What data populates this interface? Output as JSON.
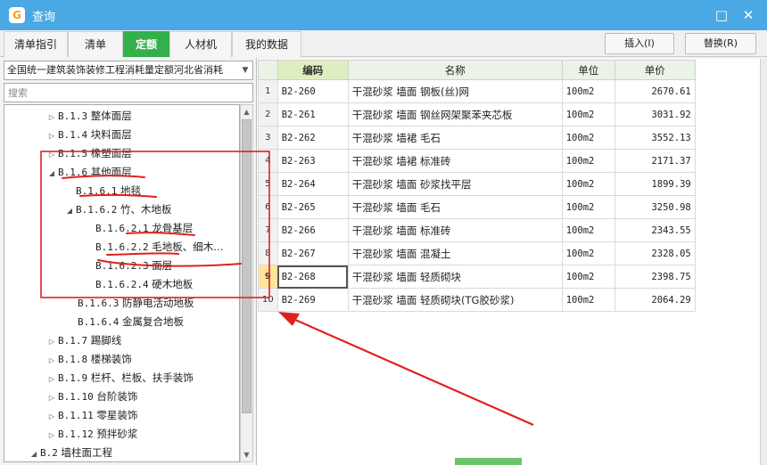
{
  "window": {
    "title": "查询",
    "app_icon": "G",
    "maximize_icon": "□",
    "close_icon": "✕"
  },
  "tabs": [
    "清单指引",
    "清单",
    "定额",
    "人材机",
    "我的数据"
  ],
  "active_tab": 2,
  "toolbar": {
    "insert_label": "插入(I)",
    "replace_label": "替换(R)"
  },
  "quota_library": {
    "selected": "全国统一建筑装饰装修工程消耗量定额河北省消耗"
  },
  "search": {
    "placeholder": "搜索"
  },
  "tree": [
    {
      "code": "B.1.3",
      "label": "整体面层"
    },
    {
      "code": "B.1.4",
      "label": "块料面层"
    },
    {
      "code": "B.1.5",
      "label": "橡塑面层"
    },
    {
      "code": "B.1.6",
      "label": "其他面层"
    },
    {
      "code": "B.1.6.1",
      "label": "地毯"
    },
    {
      "code": "B.1.6.2",
      "label": "竹、木地板"
    },
    {
      "code": "B.1.6.2.1",
      "label": "龙骨基层"
    },
    {
      "code": "B.1.6.2.2",
      "label": "毛地板、细木…"
    },
    {
      "code": "B.1.6.2.3",
      "label": "面层"
    },
    {
      "code": "B.1.6.2.4",
      "label": "硬木地板"
    },
    {
      "code": "B.1.6.3",
      "label": "防静电活动地板"
    },
    {
      "code": "B.1.6.4",
      "label": "金属复合地板"
    },
    {
      "code": "B.1.7",
      "label": "踢脚线"
    },
    {
      "code": "B.1.8",
      "label": "楼梯装饰"
    },
    {
      "code": "B.1.9",
      "label": "栏杆、栏板、扶手装饰"
    },
    {
      "code": "B.1.10",
      "label": "台阶装饰"
    },
    {
      "code": "B.1.11",
      "label": "零星装饰"
    },
    {
      "code": "B.1.12",
      "label": "预拌砂浆"
    },
    {
      "code": "B.2",
      "label": "墙柱面工程"
    }
  ],
  "table": {
    "columns": [
      "编码",
      "名称",
      "单位",
      "单价"
    ],
    "selected_row": 9,
    "rows": [
      {
        "num": "1",
        "code": "B2-260",
        "name": "干混砂浆 墙面 钢板(丝)网",
        "unit": "100m2",
        "price": "2670.61"
      },
      {
        "num": "2",
        "code": "B2-261",
        "name": "干混砂浆 墙面 钢丝网架聚苯夹芯板",
        "unit": "100m2",
        "price": "3031.92"
      },
      {
        "num": "3",
        "code": "B2-262",
        "name": "干混砂浆 墙裙 毛石",
        "unit": "100m2",
        "price": "3552.13"
      },
      {
        "num": "4",
        "code": "B2-263",
        "name": "干混砂浆 墙裙 标准砖",
        "unit": "100m2",
        "price": "2171.37"
      },
      {
        "num": "5",
        "code": "B2-264",
        "name": "干混砂浆 墙面 砂浆找平层",
        "unit": "100m2",
        "price": "1899.39"
      },
      {
        "num": "6",
        "code": "B2-265",
        "name": "干混砂浆 墙面 毛石",
        "unit": "100m2",
        "price": "3250.98"
      },
      {
        "num": "7",
        "code": "B2-266",
        "name": "干混砂浆 墙面 标准砖",
        "unit": "100m2",
        "price": "2343.55"
      },
      {
        "num": "8",
        "code": "B2-267",
        "name": "干混砂浆 墙面 混凝土",
        "unit": "100m2",
        "price": "2328.05"
      },
      {
        "num": "9",
        "code": "B2-268",
        "name": "干混砂浆 墙面 轻质砌块",
        "unit": "100m2",
        "price": "2398.75"
      },
      {
        "num": "10",
        "code": "B2-269",
        "name": "干混砂浆 墙面 轻质砌块(TG胶砂浆)",
        "unit": "100m2",
        "price": "2064.29"
      }
    ]
  },
  "colors": {
    "titlebar": "#4aa9e4",
    "active_tab": "#34b04a",
    "annotation": "#e02020"
  }
}
